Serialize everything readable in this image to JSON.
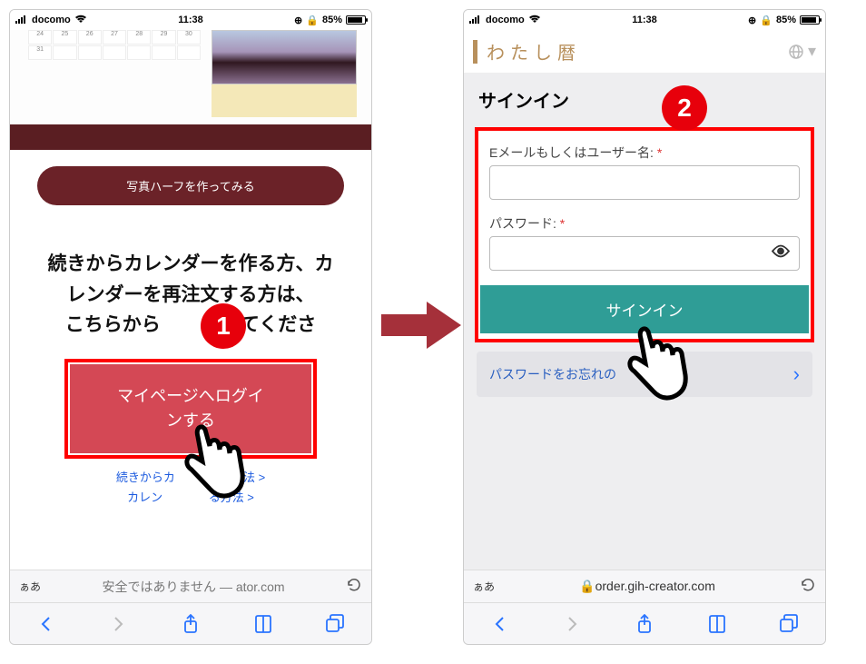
{
  "status_bar": {
    "carrier": "docomo",
    "time": "11:38",
    "battery_pct": "85%"
  },
  "phone1": {
    "pill_label": "写真ハーフを作ってみる",
    "instruction_l1": "続きからカレンダーを作る方、カ",
    "instruction_l2": "レンダーを再注文する方は、",
    "instruction_l3": "こちらから",
    "instruction_l3b": "ンしてくださ",
    "login_l1": "マイページへログイ",
    "login_l2": "ンする",
    "link1": "続きからカ",
    "link1b": "作る方法 >",
    "link2": "カレン",
    "link2b": "る方法 >",
    "addr_left": "ぁあ",
    "addr_text": "安全ではありません — ator.com"
  },
  "phone2": {
    "logo": "わたし暦",
    "section_title": "サインイン",
    "label_email": "Eメールもしくはユーザー名:",
    "label_password": "パスワード:",
    "required": "*",
    "signin_btn": "サインイン",
    "forgot": "パスワードをお忘れの",
    "addr_left": "ぁあ",
    "addr_text": "order.gih-creator.com"
  },
  "steps": {
    "one": "1",
    "two": "2"
  }
}
